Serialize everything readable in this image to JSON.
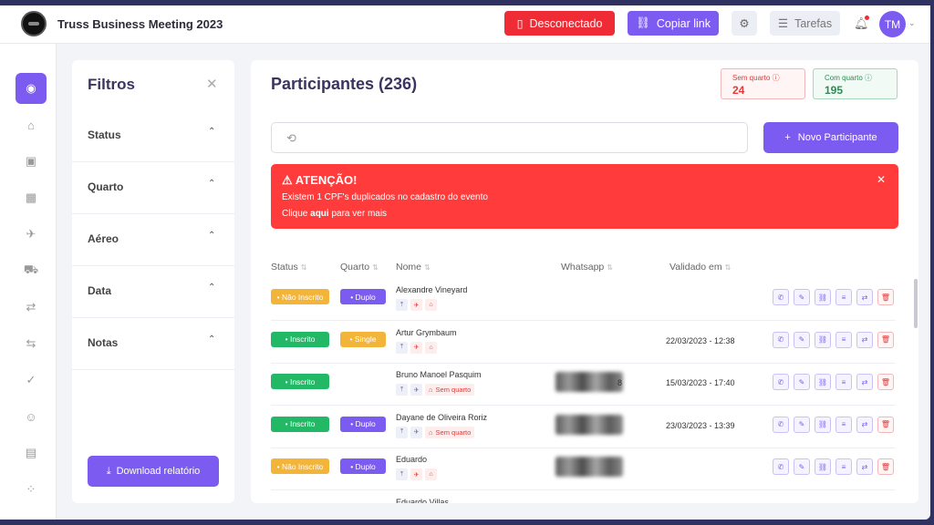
{
  "header": {
    "app_title": "Truss Business Meeting 2023",
    "disconnected_label": "Desconectado",
    "copy_link_label": "Copiar link",
    "tasks_label": "Tarefas",
    "avatar_initials": "TM"
  },
  "sidebar": {
    "items": [
      {
        "icon": "user-icon",
        "glyph": "◉",
        "active": true
      },
      {
        "icon": "building-icon",
        "glyph": "⌂"
      },
      {
        "icon": "document-icon",
        "glyph": "▣"
      },
      {
        "icon": "hotel-icon",
        "glyph": "▦"
      },
      {
        "icon": "airplane-icon",
        "glyph": "✈"
      },
      {
        "icon": "car-icon",
        "glyph": "⛟"
      },
      {
        "icon": "transfer-icon",
        "glyph": "⇄"
      },
      {
        "icon": "route-icon",
        "glyph": "⇆"
      },
      {
        "icon": "shield-check-icon",
        "glyph": "✓"
      },
      {
        "icon": "smile-icon",
        "glyph": "☺"
      },
      {
        "icon": "chat-icon",
        "glyph": "▤"
      },
      {
        "icon": "apps-icon",
        "glyph": "⁘"
      }
    ]
  },
  "filters": {
    "title": "Filtros",
    "sections": [
      "Status",
      "Quarto",
      "Aéreo",
      "Data",
      "Notas"
    ],
    "download_label": "Download relatório"
  },
  "main": {
    "title": "Participantes (236)",
    "stats": {
      "sem_quarto_label": "Sem quarto",
      "sem_quarto_value": "24",
      "com_quarto_label": "Com quarto",
      "com_quarto_value": "195"
    },
    "search_placeholder": "",
    "new_button_label": "Novo Participante",
    "alert": {
      "title": "ATENÇÃO!",
      "line1": "Existem 1 CPF's duplicados no cadastro do evento",
      "line2_prefix": "Clique ",
      "line2_link": "aqui",
      "line2_suffix": " para ver mais"
    },
    "columns": {
      "status": "Status",
      "quarto": "Quarto",
      "nome": "Nome",
      "whatsapp": "Whatsapp",
      "validado": "Validado em"
    },
    "rows": [
      {
        "status": "Não Inscrito",
        "status_type": "nao",
        "quarto": "Duplo",
        "quarto_type": "duplo",
        "name": "Alexandre Vineyard",
        "flight_icon": "no-flight",
        "room_tag": "",
        "whatsapp_blurred": false,
        "whatsapp_suffix": "",
        "validado": ""
      },
      {
        "status": "Inscrito",
        "status_type": "ins",
        "quarto": "Single",
        "quarto_type": "single",
        "name": "Artur Grymbaum",
        "flight_icon": "no-flight",
        "room_tag": "",
        "whatsapp_blurred": false,
        "whatsapp_suffix": "",
        "validado": "22/03/2023 - 12:38"
      },
      {
        "status": "Inscrito",
        "status_type": "ins",
        "quarto": "",
        "quarto_type": "",
        "name": "Bruno Manoel Pasquim",
        "flight_icon": "flight",
        "room_tag": "Sem quarto",
        "whatsapp_blurred": true,
        "whatsapp_suffix": "8",
        "validado": "15/03/2023 - 17:40"
      },
      {
        "status": "Inscrito",
        "status_type": "ins",
        "quarto": "Duplo",
        "quarto_type": "duplo",
        "name": "Dayane de Oliveira Roriz",
        "flight_icon": "flight",
        "room_tag": "Sem quarto",
        "whatsapp_blurred": true,
        "whatsapp_suffix": "",
        "validado": "23/03/2023 - 13:39"
      },
      {
        "status": "Não Inscrito",
        "status_type": "nao",
        "quarto": "Duplo",
        "quarto_type": "duplo",
        "name": "Eduardo",
        "flight_icon": "no-flight",
        "room_tag": "",
        "whatsapp_blurred": true,
        "whatsapp_suffix": "",
        "validado": ""
      },
      {
        "status": "",
        "status_type": "nao",
        "quarto": "",
        "quarto_type": "single",
        "name": "Eduardo Villas",
        "flight_icon": "",
        "room_tag": "",
        "whatsapp_blurred": false,
        "whatsapp_suffix": "",
        "validado": ""
      }
    ],
    "row_actions": [
      "whatsapp-icon",
      "edit-icon",
      "link-icon",
      "list-icon",
      "swap-icon",
      "trash-icon"
    ]
  },
  "colors": {
    "accent": "#7c5cf0",
    "danger": "#ef2b35",
    "success": "#22b866",
    "warning": "#f2b53a"
  }
}
